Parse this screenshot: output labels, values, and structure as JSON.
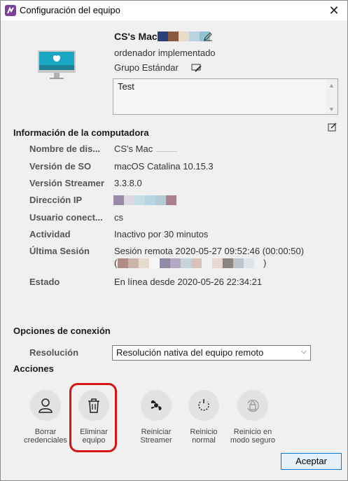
{
  "window": {
    "title": "Configuración del equipo"
  },
  "device": {
    "name": "CS's Mac",
    "name_swatches": [
      "#2b3f78",
      "#8a5a40",
      "#e8dcc7",
      "#b9d4de",
      "#8fc3cf"
    ],
    "type": "ordenador implementado",
    "group": "Grupo Estándar",
    "notes": "Test"
  },
  "info": {
    "title": "Información de la computadora",
    "rows": [
      {
        "label": "Nombre de dis...",
        "value": "CS's Mac"
      },
      {
        "label": "Versión de SO",
        "value": "macOS Catalina 10.15.3"
      },
      {
        "label": "Versión Streamer",
        "value": "3.3.8.0"
      },
      {
        "label": "Dirección IP",
        "value": ""
      },
      {
        "label": "Usuario conect...",
        "value": "cs"
      },
      {
        "label": "Actividad",
        "value": "Inactivo por 30 minutos"
      },
      {
        "label": "Última Sesión",
        "value": "Sesión remota 2020-05-27 09:52:46 (00:00:50)"
      },
      {
        "label": "Estado",
        "value": "En línea desde 2020-05-26 22:34:21"
      }
    ],
    "ip_swatches": [
      "#9a8aa8",
      "#dcd8e4",
      "#c5dde6",
      "#b5d6e2",
      "#b3ccd6",
      "#a9808c"
    ],
    "session_swatches": [
      "#b08a84",
      "#c8b4a8",
      "#e6dccb",
      "#f5f5f5",
      "#8e8aa4",
      "#b3a8c0",
      "#c8d2dc",
      "#d8c4b8",
      "#f0f0f0",
      "#e8d8d4",
      "#8c8480",
      "#bcc4cc",
      "#dce4ec"
    ],
    "session_paren_open": "(",
    "session_paren_close": ")"
  },
  "connection": {
    "title": "Opciones de conexión",
    "resolution_label": "Resolución",
    "resolution_value": "Resolución nativa del equipo remoto"
  },
  "actions": {
    "title": "Acciones",
    "items": [
      {
        "line1": "Borrar",
        "line2": "credenciales",
        "icon": "user-icon"
      },
      {
        "line1": "Eliminar",
        "line2": "equipo",
        "icon": "trash-icon"
      },
      {
        "line1": "Reiniciar",
        "line2": "Streamer",
        "icon": "streamer-icon"
      },
      {
        "line1": "Reinicio",
        "line2": "normal",
        "icon": "restart-icon"
      },
      {
        "line1": "Reinicio en",
        "line2": "modo seguro",
        "icon": "lock-restart-icon"
      }
    ]
  },
  "footer": {
    "accept_label": "Aceptar"
  },
  "colors": {
    "accent": "#0078d7",
    "highlight": "#d71313",
    "brand": "#7b4397"
  }
}
